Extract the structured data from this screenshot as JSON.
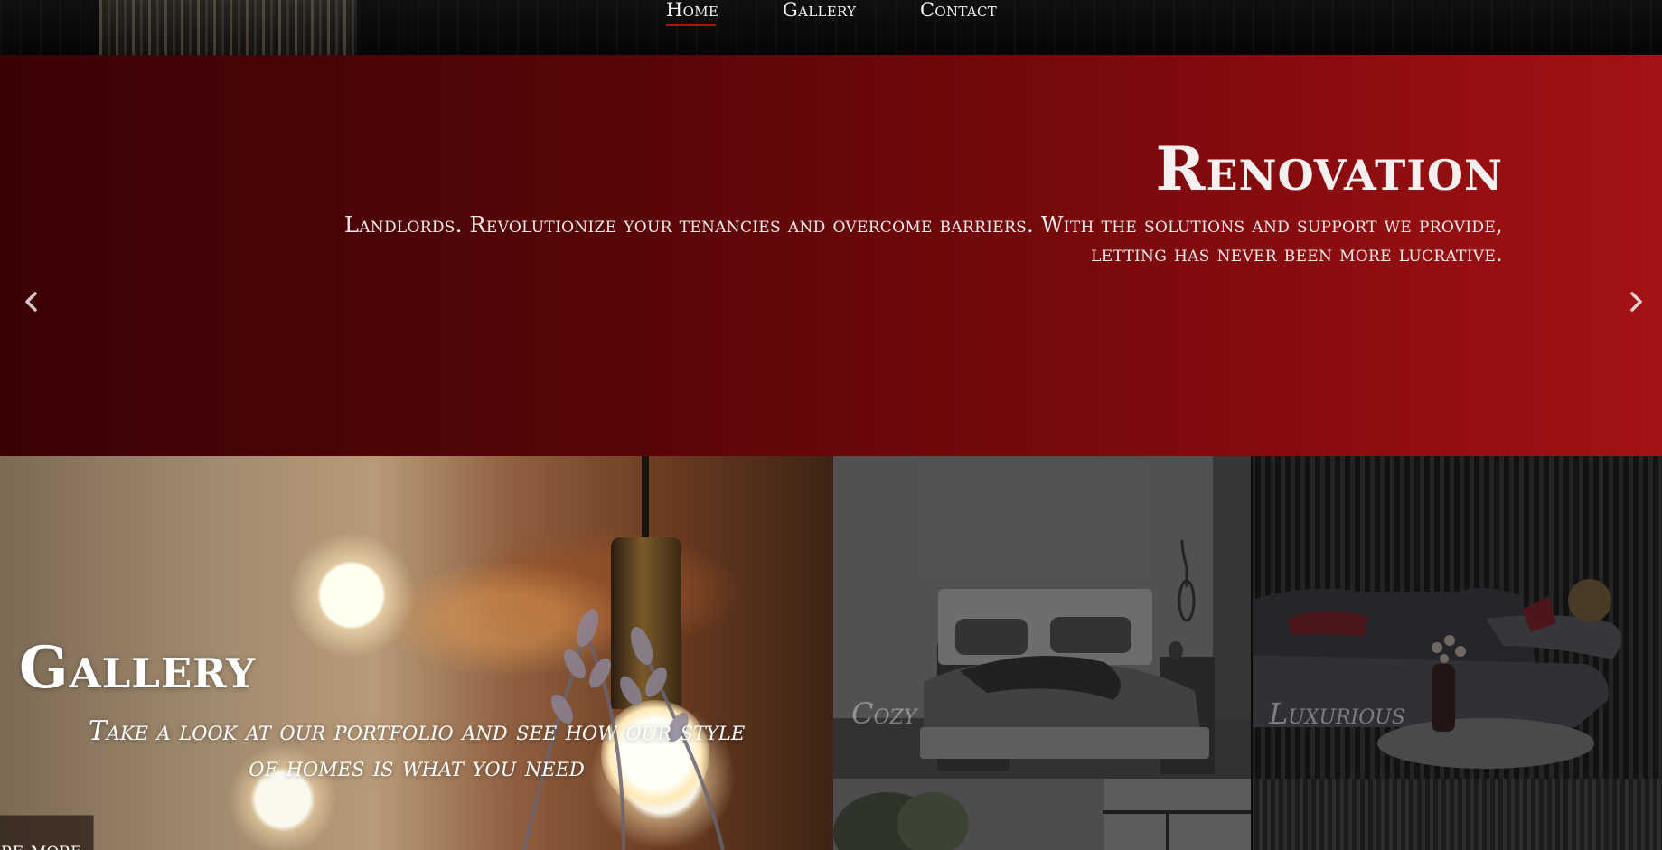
{
  "nav": {
    "items": [
      {
        "label": "Home",
        "active": true
      },
      {
        "label": "Gallery",
        "active": false
      },
      {
        "label": "Contact",
        "active": false
      }
    ]
  },
  "hero": {
    "title": "Renovation",
    "subtitle": "Landlords. Revolutionize your tenancies and overcome barriers. With the solutions and support we provide, letting has never been more lucrative.",
    "prev_icon": "chevron-left-icon",
    "next_icon": "chevron-right-icon"
  },
  "gallery": {
    "title": "Gallery",
    "subtitle_line1": "Take a look at our portfolio and see how our style",
    "subtitle_line2": "of homes is what you need",
    "more_button": "re more"
  },
  "tiles": [
    {
      "label": "Cozy"
    },
    {
      "label": "Luxurious"
    }
  ],
  "colors": {
    "accent": "#b01515",
    "hero_start": "#3a0205",
    "hero_end": "#a41214"
  }
}
